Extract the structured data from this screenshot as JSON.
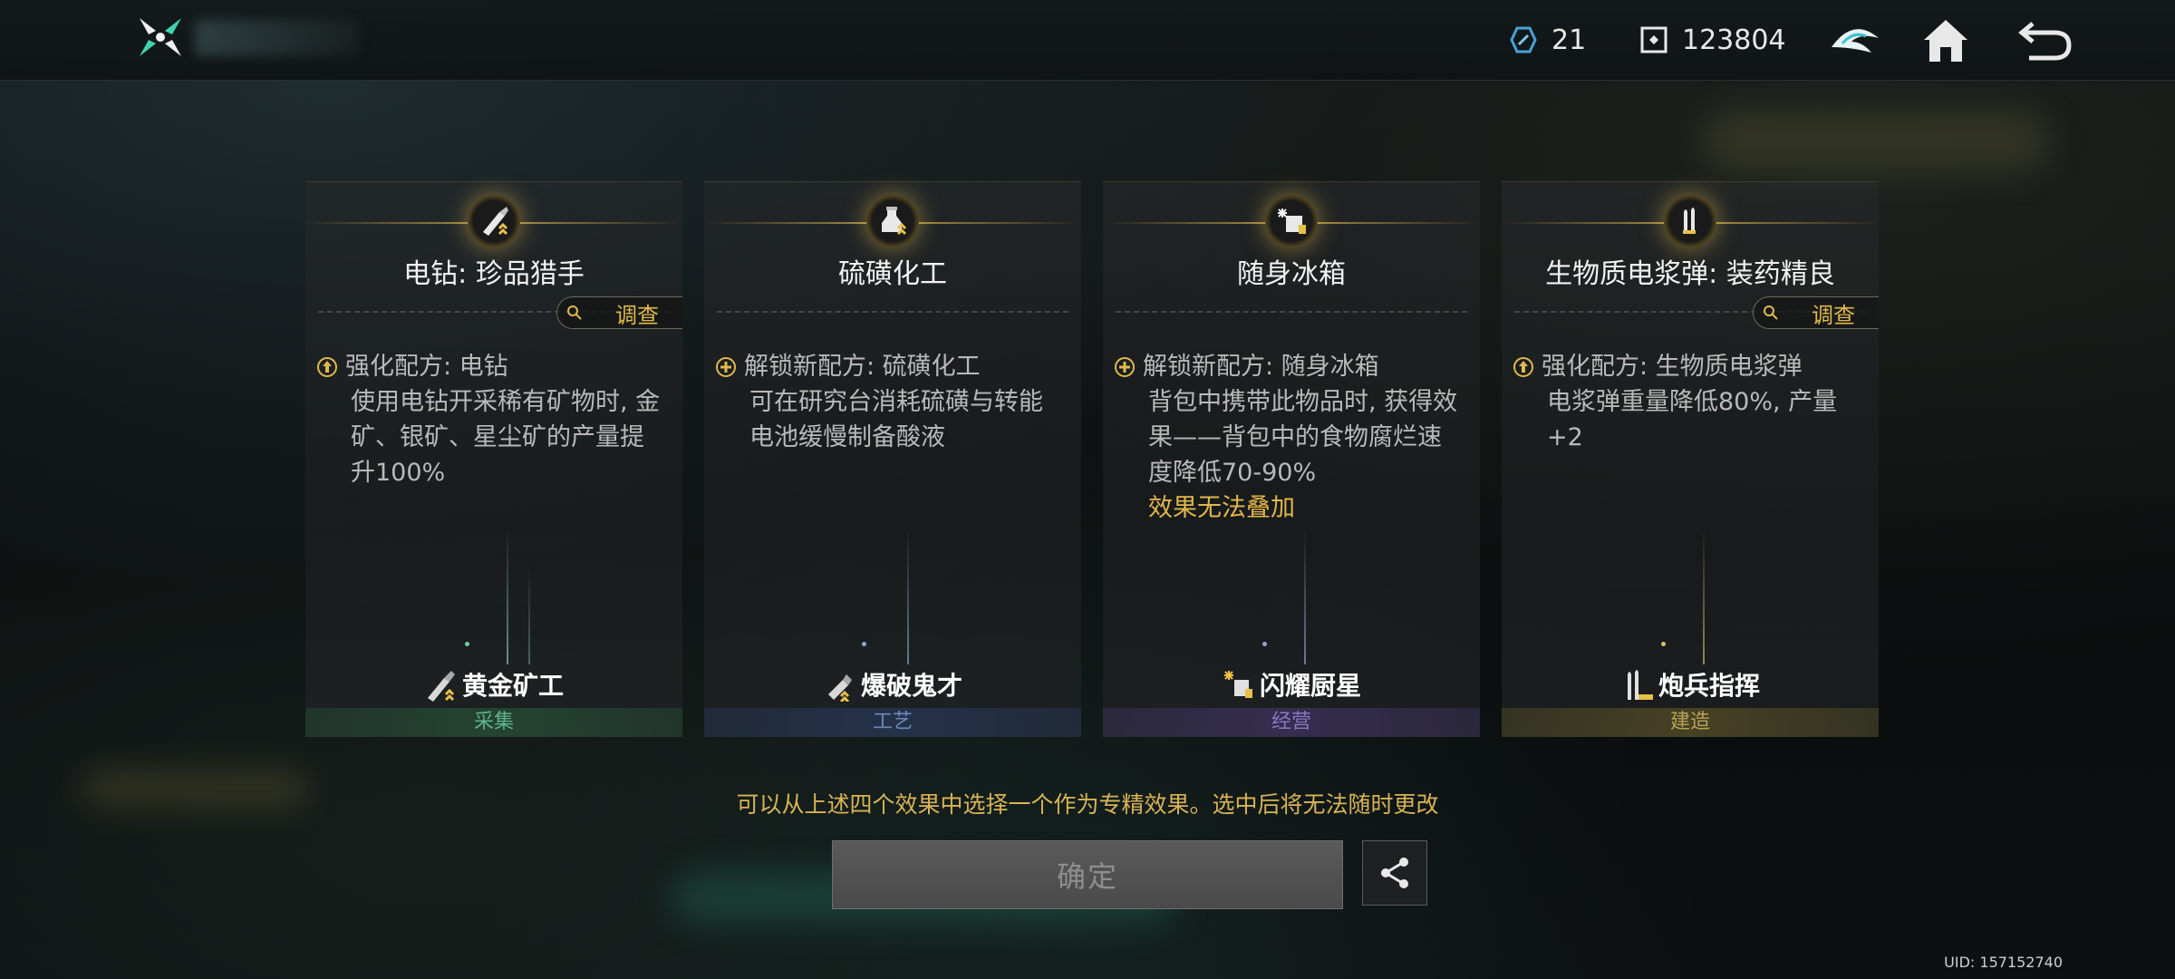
{
  "header": {
    "resource_1": {
      "icon": "energy-crystal-icon",
      "value": "21"
    },
    "resource_2": {
      "icon": "coin-icon",
      "value": "123804"
    },
    "icons": [
      "emblem-icon",
      "home-icon",
      "back-icon"
    ]
  },
  "cards": [
    {
      "icon": "drill-icon",
      "title": "电钻: 珍品猎手",
      "investigate": "调查",
      "effect_icon": "upgrade-icon",
      "effect_title": "强化配方: 电钻",
      "effect_body": "使用电钻开采稀有矿物时, 金矿、银矿、星尘矿的产量提升100%",
      "warn": "",
      "role": "黄金矿工",
      "tag": "采集",
      "color": "#5db38a"
    },
    {
      "icon": "sulfur-bottle-icon",
      "title": "硫磺化工",
      "investigate": "",
      "effect_icon": "unlock-plus-icon",
      "effect_title": "解锁新配方: 硫磺化工",
      "effect_body": "可在研究台消耗硫磺与转能电池缓慢制备酸液",
      "warn": "",
      "role": "爆破鬼才",
      "tag": "工艺",
      "color": "#6f88b8"
    },
    {
      "icon": "ice-box-icon",
      "title": "随身冰箱",
      "investigate": "",
      "effect_icon": "unlock-plus-icon",
      "effect_title": "解锁新配方: 随身冰箱",
      "effect_body": "背包中携带此物品时, 获得效果——背包中的食物腐烂速度降低70-90%",
      "warn": "效果无法叠加",
      "role": "闪耀厨星",
      "tag": "经营",
      "color": "#8a78c0"
    },
    {
      "icon": "bio-slurry-ammo-icon",
      "title": "生物质电浆弹: 装药精良",
      "investigate": "调查",
      "effect_icon": "upgrade-icon",
      "effect_title": "强化配方: 生物质电浆弹",
      "effect_body": "电浆弹重量降低80%, 产量+2",
      "warn": "",
      "role": "炮兵指挥",
      "tag": "建造",
      "color": "#b8a455"
    }
  ],
  "hint": "可以从上述四个效果中选择一个作为专精效果。选中后将无法随时更改",
  "confirm_label": "确定",
  "share_icon": "share-icon",
  "uid": "UID: 157152740"
}
